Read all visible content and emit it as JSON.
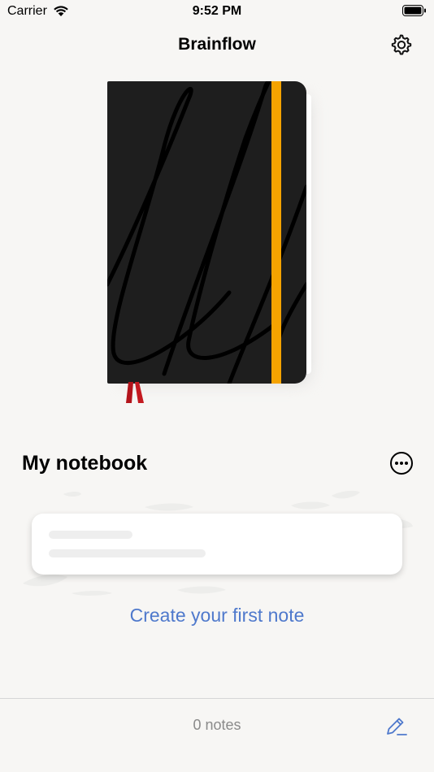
{
  "status_bar": {
    "carrier": "Carrier",
    "time": "9:52 PM",
    "icons": [
      "wifi-icon",
      "battery-icon"
    ]
  },
  "nav": {
    "title": "Brainflow",
    "settings_icon": "gear-icon"
  },
  "notebook": {
    "cover_color": "#1e1e1e",
    "band_color": "#f5a300",
    "ribbon_color": "#b3141b",
    "pattern": "script-lines"
  },
  "section": {
    "title": "My notebook",
    "more_icon": "ellipsis-circle-icon"
  },
  "empty_state": {
    "cta": "Create your first note"
  },
  "toolbar": {
    "notes_count": "0 notes",
    "compose_icon": "pencil-icon"
  },
  "colors": {
    "background": "#f7f6f4",
    "accent": "#4f79cc",
    "muted_text": "#8a8a8a"
  }
}
